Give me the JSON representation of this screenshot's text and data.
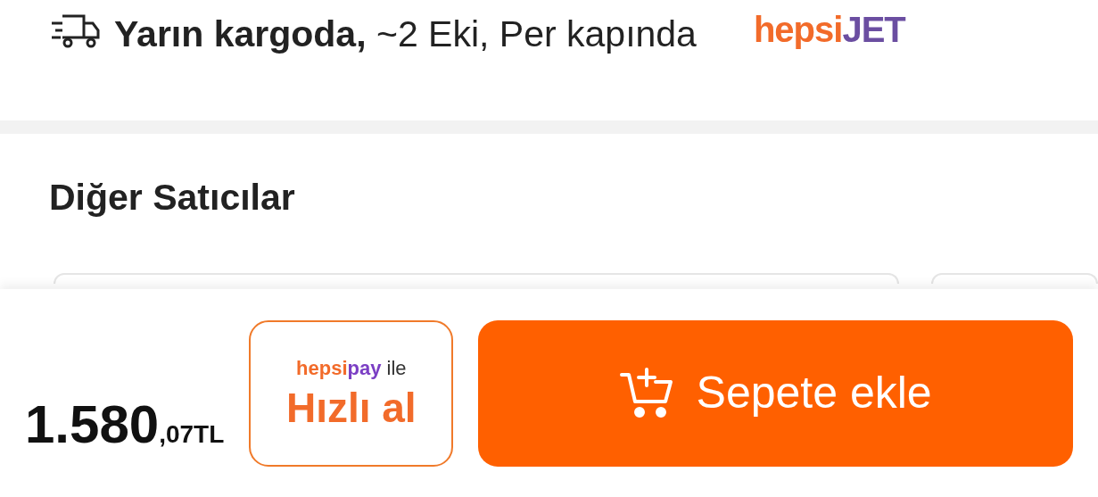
{
  "delivery": {
    "text": "**Yarın kargoda,** ~2 Eki, Per kapında",
    "carrier_logo": {
      "part_1": "hepsi",
      "part_2": "JET"
    }
  },
  "other_sellers": {
    "title": "Diğer Satıcılar",
    "cards": [
      {
        "kind": "card"
      },
      {
        "kind": "card"
      }
    ]
  },
  "bottom_bar": {
    "price": {
      "main": "1.580",
      "fraction": ",07TL"
    },
    "quick_buy": {
      "logo_part_1": "hepsi",
      "logo_part_2": "pay",
      "suffix": "ile",
      "label": "Hızlı al"
    },
    "add_to_cart": {
      "label": "Sepete ekle"
    }
  }
}
